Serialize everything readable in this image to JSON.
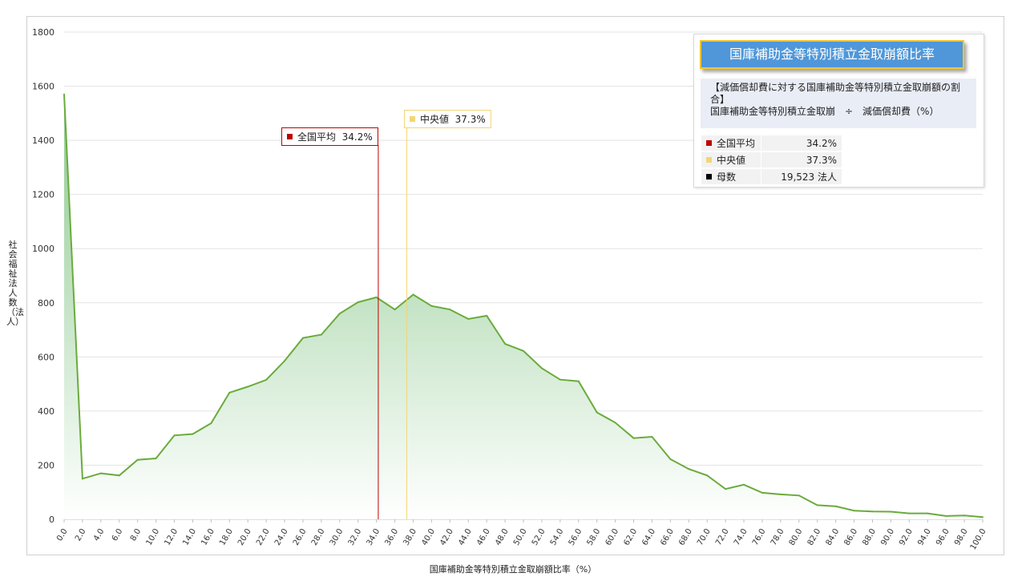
{
  "chart_data": {
    "type": "area",
    "ylabel": "社会福祉法人数（法人）",
    "xlabel": "国庫補助金等特別積立金取崩額比率（%）",
    "ylim": [
      0,
      1800
    ],
    "yticks": [
      0,
      200,
      400,
      600,
      800,
      1000,
      1200,
      1400,
      1600,
      1800
    ],
    "x": [
      "0.0",
      "2.0",
      "4.0",
      "6.0",
      "8.0",
      "10.0",
      "12.0",
      "14.0",
      "16.0",
      "18.0",
      "20.0",
      "22.0",
      "24.0",
      "26.0",
      "28.0",
      "30.0",
      "32.0",
      "34.0",
      "36.0",
      "38.0",
      "40.0",
      "42.0",
      "44.0",
      "46.0",
      "48.0",
      "50.0",
      "52.0",
      "54.0",
      "56.0",
      "58.0",
      "60.0",
      "62.0",
      "64.0",
      "66.0",
      "68.0",
      "70.0",
      "72.0",
      "74.0",
      "76.0",
      "78.0",
      "80.0",
      "82.0",
      "84.0",
      "86.0",
      "88.0",
      "90.0",
      "92.0",
      "94.0",
      "96.0",
      "98.0",
      "100.0"
    ],
    "values": [
      1570,
      150,
      170,
      162,
      220,
      225,
      310,
      315,
      355,
      468,
      490,
      515,
      585,
      670,
      682,
      760,
      802,
      820,
      775,
      830,
      788,
      775,
      740,
      752,
      648,
      622,
      558,
      516,
      510,
      395,
      357,
      300,
      305,
      222,
      186,
      162,
      112,
      128,
      98,
      92,
      88,
      52,
      48,
      32,
      29,
      28,
      22,
      22,
      12,
      14,
      8
    ],
    "grid": true,
    "colors": {
      "line": "#6aab3c",
      "fill_top": "#8cc98e",
      "fill_bottom": "#ffffff",
      "avg": "#c00000",
      "median": "#f2d675",
      "count": "#000000"
    },
    "markers": [
      {
        "label": "全国平均",
        "value_text": "34.2%",
        "x": 34.2
      },
      {
        "label": "中央値",
        "value_text": "37.3%",
        "x": 37.3
      }
    ]
  },
  "info": {
    "title": "国庫補助金等特別積立金取崩額比率",
    "desc_line1": "【減価償却費に対する国庫補助金等特別積立金取崩額の割合】",
    "desc_line2": "国庫補助金等特別積立金取崩　÷　減価償却費（%）",
    "stats": [
      {
        "label": "全国平均",
        "value": "34.2%"
      },
      {
        "label": "中央値",
        "value": "37.3%"
      },
      {
        "label": "母数",
        "value": "19,523  法人"
      }
    ]
  }
}
